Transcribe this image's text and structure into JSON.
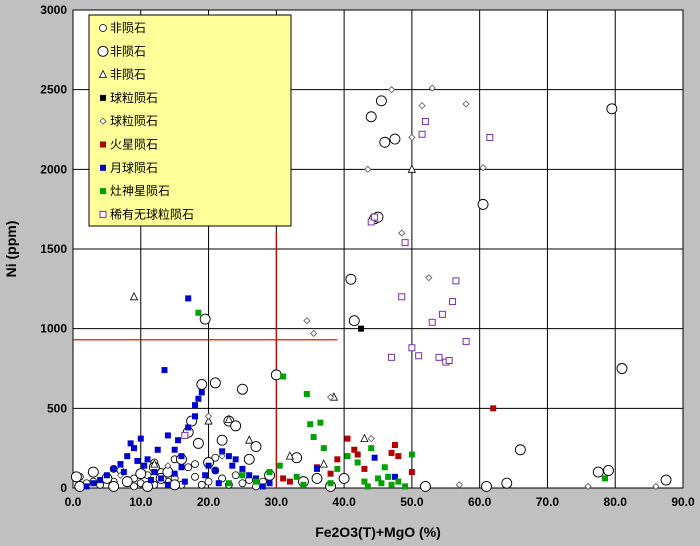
{
  "chart_data": {
    "type": "scatter",
    "xlabel": "Fe2O3(T)+MgO  (%)",
    "ylabel": "Ni  (ppm)",
    "xlim": [
      0,
      90
    ],
    "ylim": [
      0,
      3000
    ],
    "xticks": [
      0,
      10,
      20,
      30,
      40,
      50,
      60,
      70,
      80,
      90
    ],
    "xtick_labels": [
      "0.0",
      "10.0",
      "20.0",
      "30.0",
      "40.0",
      "50.0",
      "60.0",
      "70.0",
      "80.0",
      "90.0"
    ],
    "yticks": [
      0,
      500,
      1000,
      1500,
      2000,
      2500,
      3000
    ],
    "ytick_labels": [
      "0",
      "500",
      "1000",
      "1500",
      "2000",
      "2500",
      "3000"
    ],
    "grid": true,
    "legend_position": "top-left",
    "reference_lines": [
      {
        "orientation": "vertical",
        "x": 30,
        "y_from": 0,
        "y_to": 1600,
        "color": "#cc0000"
      },
      {
        "orientation": "horizontal",
        "y": 930,
        "x_from": 0,
        "x_to": 39,
        "color": "#cc0000"
      }
    ],
    "series": [
      {
        "name": "非陨石",
        "marker": "circle-small",
        "color": "#000000",
        "points": [
          [
            1,
            70
          ],
          [
            2,
            30
          ],
          [
            3,
            90
          ],
          [
            4,
            20
          ],
          [
            5,
            60
          ],
          [
            6,
            40
          ],
          [
            7,
            110
          ],
          [
            8,
            50
          ],
          [
            9,
            10
          ],
          [
            10,
            30
          ],
          [
            11,
            80
          ],
          [
            12,
            20
          ],
          [
            13,
            100
          ],
          [
            14,
            40
          ],
          [
            15,
            60
          ],
          [
            16,
            20
          ],
          [
            17,
            130
          ],
          [
            18,
            70
          ],
          [
            19,
            20
          ],
          [
            20,
            40
          ],
          [
            21,
            110
          ],
          [
            22,
            60
          ],
          [
            23,
            20
          ],
          [
            24,
            80
          ],
          [
            25,
            30
          ],
          [
            26,
            50
          ],
          [
            27,
            10
          ],
          [
            28,
            40
          ],
          [
            15,
            180
          ],
          [
            18,
            150
          ],
          [
            21,
            190
          ],
          [
            12,
            160
          ],
          [
            9,
            60
          ],
          [
            6,
            120
          ],
          [
            3,
            40
          ]
        ]
      },
      {
        "name": "非陨石",
        "marker": "circle-large",
        "color": "#000000",
        "points": [
          [
            0.5,
            70
          ],
          [
            1,
            10
          ],
          [
            3,
            100
          ],
          [
            5,
            60
          ],
          [
            6,
            10
          ],
          [
            8,
            40
          ],
          [
            10,
            90
          ],
          [
            11,
            10
          ],
          [
            12,
            130
          ],
          [
            13,
            60
          ],
          [
            14,
            100
          ],
          [
            15,
            20
          ],
          [
            16,
            180
          ],
          [
            17,
            350
          ],
          [
            17.5,
            420
          ],
          [
            18.5,
            280
          ],
          [
            19,
            650
          ],
          [
            19.5,
            1060
          ],
          [
            20,
            160
          ],
          [
            21,
            660
          ],
          [
            22,
            300
          ],
          [
            23,
            420
          ],
          [
            24,
            390
          ],
          [
            25,
            620
          ],
          [
            26,
            180
          ],
          [
            27,
            260
          ],
          [
            29,
            80
          ],
          [
            30,
            710
          ],
          [
            33,
            190
          ],
          [
            34,
            40
          ],
          [
            36,
            60
          ],
          [
            38,
            10
          ],
          [
            40,
            60
          ],
          [
            41,
            1310
          ],
          [
            41.5,
            1050
          ],
          [
            44,
            2330
          ],
          [
            44.5,
            1690
          ],
          [
            45,
            1700
          ],
          [
            45.5,
            2430
          ],
          [
            46,
            2170
          ],
          [
            47.5,
            2190
          ],
          [
            52,
            10
          ],
          [
            60.5,
            1780
          ],
          [
            61,
            10
          ],
          [
            64,
            30
          ],
          [
            66,
            240
          ],
          [
            77.5,
            100
          ],
          [
            79,
            110
          ],
          [
            79.5,
            2380
          ],
          [
            81,
            750
          ],
          [
            87.5,
            50
          ]
        ]
      },
      {
        "name": "非陨石",
        "marker": "triangle",
        "color": "#000000",
        "points": [
          [
            9,
            1200
          ],
          [
            12,
            150
          ],
          [
            20,
            420
          ],
          [
            23,
            430
          ],
          [
            26,
            300
          ],
          [
            32,
            200
          ],
          [
            37,
            150
          ],
          [
            38.5,
            570
          ],
          [
            43,
            310
          ],
          [
            50,
            2000
          ]
        ]
      },
      {
        "name": "球粒陨石",
        "marker": "square",
        "color": "#000000",
        "points": [
          [
            42.5,
            1000
          ]
        ]
      },
      {
        "name": "球粒陨石",
        "marker": "diamond",
        "color": "#555555",
        "points": [
          [
            7,
            80
          ],
          [
            14,
            140
          ],
          [
            20,
            450
          ],
          [
            22,
            200
          ],
          [
            25,
            100
          ],
          [
            34.5,
            1050
          ],
          [
            35.5,
            970
          ],
          [
            38,
            570
          ],
          [
            43.5,
            2000
          ],
          [
            44,
            310
          ],
          [
            47,
            2500
          ],
          [
            48.5,
            1600
          ],
          [
            50,
            2200
          ],
          [
            51.5,
            2400
          ],
          [
            52.5,
            1320
          ],
          [
            53,
            2510
          ],
          [
            57,
            20
          ],
          [
            58,
            2410
          ],
          [
            60.5,
            2010
          ],
          [
            76,
            10
          ],
          [
            86,
            10
          ]
        ]
      },
      {
        "name": "火星陨石",
        "marker": "square",
        "color": "#b00000",
        "points": [
          [
            31,
            60
          ],
          [
            32,
            40
          ],
          [
            36,
            130
          ],
          [
            38,
            90
          ],
          [
            39,
            180
          ],
          [
            40.5,
            310
          ],
          [
            41.5,
            240
          ],
          [
            42,
            210
          ],
          [
            43,
            120
          ],
          [
            47,
            220
          ],
          [
            47.5,
            270
          ],
          [
            48,
            200
          ],
          [
            50,
            100
          ],
          [
            62,
            500
          ]
        ]
      },
      {
        "name": "月球陨石",
        "marker": "square",
        "color": "#0000cc",
        "points": [
          [
            2,
            10
          ],
          [
            3,
            30
          ],
          [
            4,
            50
          ],
          [
            5,
            80
          ],
          [
            6,
            120
          ],
          [
            7,
            150
          ],
          [
            8,
            200
          ],
          [
            9,
            250
          ],
          [
            10,
            310
          ],
          [
            11,
            180
          ],
          [
            12,
            100
          ],
          [
            13,
            60
          ],
          [
            14,
            20
          ],
          [
            15,
            90
          ],
          [
            16,
            200
          ],
          [
            17,
            1190
          ],
          [
            13.5,
            740
          ],
          [
            14,
            330
          ],
          [
            15,
            240
          ],
          [
            16,
            130
          ],
          [
            17,
            380
          ],
          [
            18,
            450
          ],
          [
            18.5,
            560
          ],
          [
            19,
            600
          ],
          [
            20,
            140
          ],
          [
            21,
            110
          ],
          [
            22,
            230
          ],
          [
            23,
            200
          ],
          [
            24,
            180
          ],
          [
            25,
            120
          ],
          [
            26,
            80
          ],
          [
            27,
            60
          ],
          [
            28,
            10
          ],
          [
            29,
            30
          ],
          [
            36,
            120
          ],
          [
            44.5,
            190
          ],
          [
            47.5,
            70
          ],
          [
            7.5,
            100
          ],
          [
            9.5,
            170
          ],
          [
            11.5,
            50
          ],
          [
            12.5,
            240
          ],
          [
            16.5,
            40
          ],
          [
            19.5,
            80
          ],
          [
            21.5,
            30
          ],
          [
            23.5,
            140
          ],
          [
            8.5,
            280
          ],
          [
            10.5,
            140
          ],
          [
            18,
            520
          ],
          [
            15.5,
            300
          ]
        ]
      },
      {
        "name": "灶神星陨石",
        "marker": "square",
        "color": "#00a000",
        "points": [
          [
            18.5,
            1100
          ],
          [
            23,
            30
          ],
          [
            25,
            80
          ],
          [
            27,
            40
          ],
          [
            29,
            100
          ],
          [
            30.5,
            140
          ],
          [
            31,
            700
          ],
          [
            33,
            70
          ],
          [
            34,
            20
          ],
          [
            34.5,
            590
          ],
          [
            35,
            400
          ],
          [
            35.5,
            320
          ],
          [
            36.5,
            410
          ],
          [
            37,
            250
          ],
          [
            38,
            30
          ],
          [
            39,
            120
          ],
          [
            40.5,
            200
          ],
          [
            42,
            160
          ],
          [
            43,
            40
          ],
          [
            43.5,
            10
          ],
          [
            44,
            250
          ],
          [
            45,
            60
          ],
          [
            45.5,
            30
          ],
          [
            46,
            130
          ],
          [
            46.5,
            70
          ],
          [
            47,
            20
          ],
          [
            48,
            40
          ],
          [
            49,
            10
          ],
          [
            50,
            210
          ],
          [
            78.5,
            60
          ]
        ]
      },
      {
        "name": "稀有无球粒陨石",
        "marker": "square-open",
        "color": "#7a30a8",
        "points": [
          [
            16.5,
            330
          ],
          [
            44,
            1670
          ],
          [
            44.5,
            1700
          ],
          [
            47,
            820
          ],
          [
            48.5,
            1200
          ],
          [
            49,
            1540
          ],
          [
            50,
            880
          ],
          [
            51,
            830
          ],
          [
            51.5,
            2220
          ],
          [
            52,
            2300
          ],
          [
            53,
            1040
          ],
          [
            54,
            820
          ],
          [
            54.5,
            1090
          ],
          [
            55,
            790
          ],
          [
            55.5,
            800
          ],
          [
            56,
            1170
          ],
          [
            56.5,
            1300
          ],
          [
            58,
            920
          ],
          [
            61.5,
            2200
          ]
        ]
      }
    ]
  }
}
